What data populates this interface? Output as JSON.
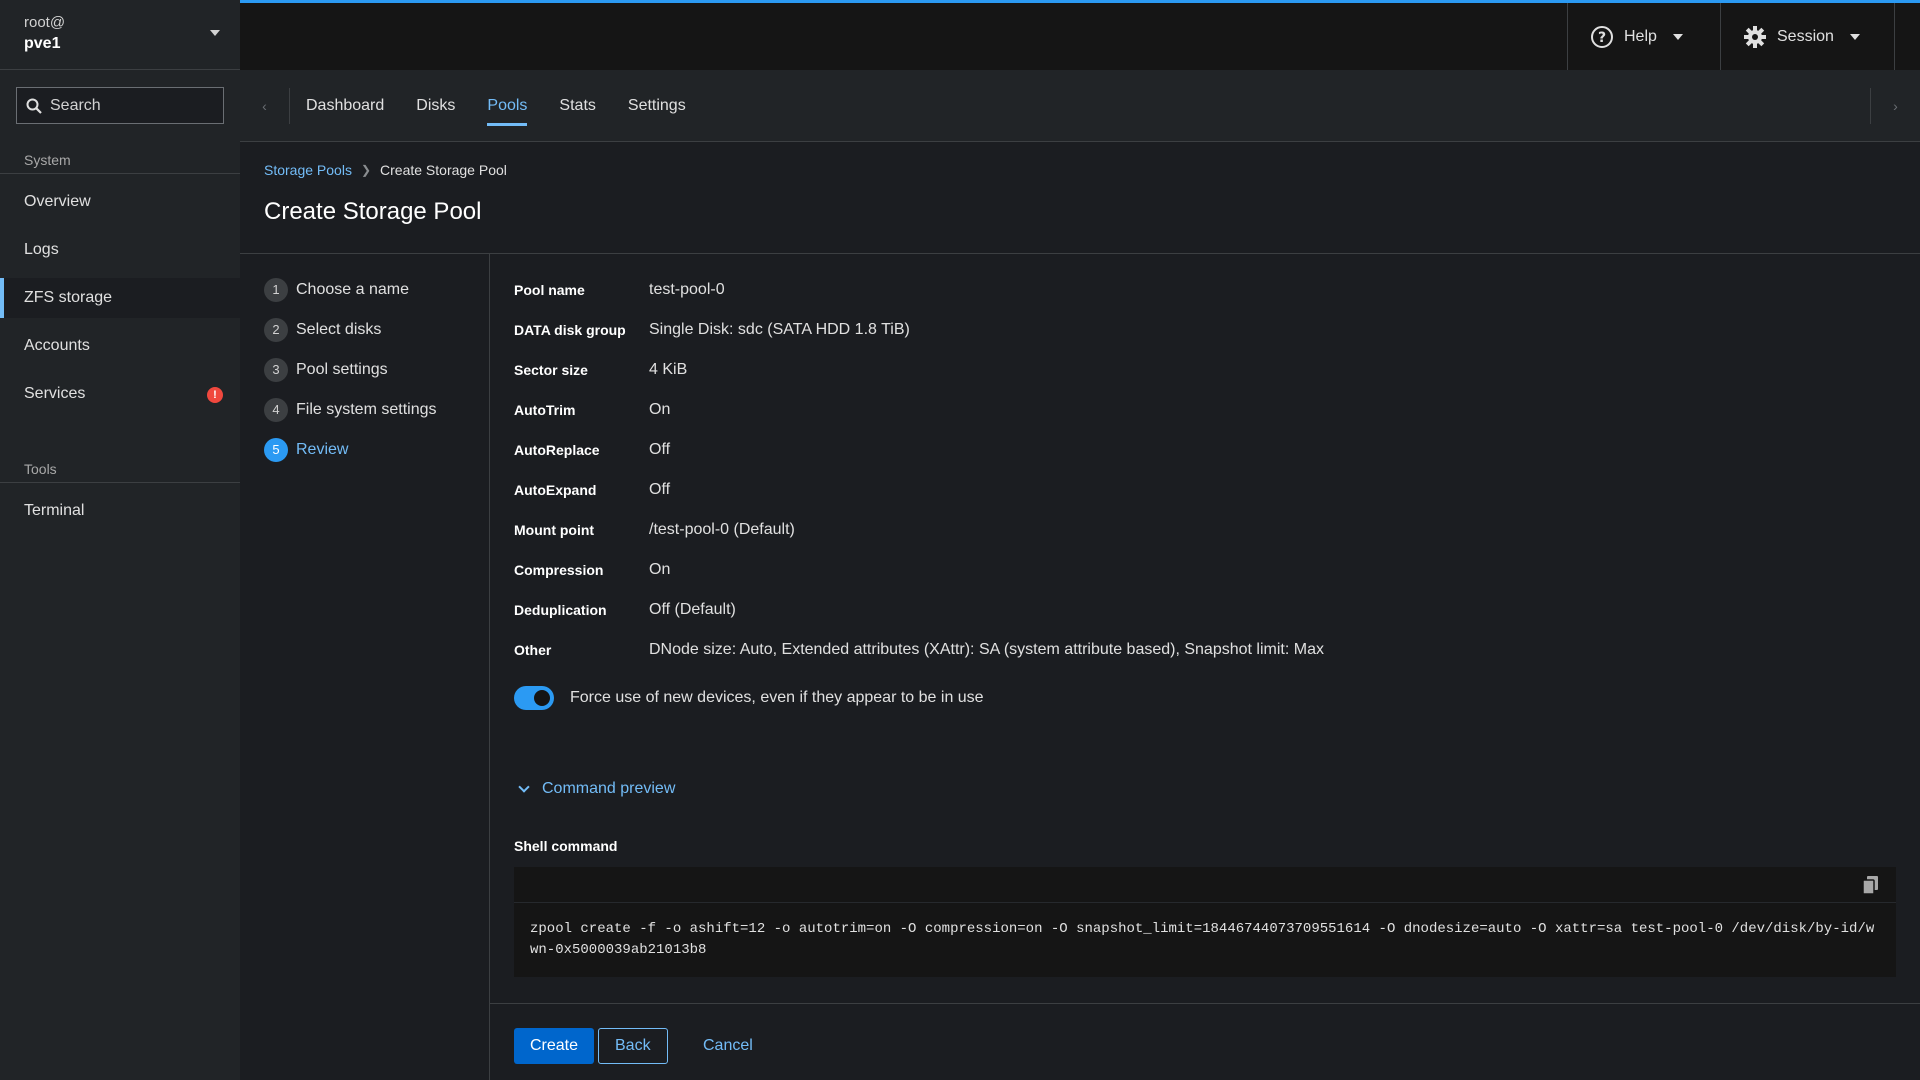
{
  "host": {
    "user": "root@",
    "name": "pve1"
  },
  "search": {
    "placeholder": "Search"
  },
  "nav": {
    "system_heading": "System",
    "system_items": [
      {
        "label": "Overview"
      },
      {
        "label": "Logs"
      },
      {
        "label": "ZFS storage",
        "active": true
      },
      {
        "label": "Accounts"
      },
      {
        "label": "Services",
        "badge": "!"
      }
    ],
    "tools_heading": "Tools",
    "tools_items": [
      {
        "label": "Terminal"
      }
    ]
  },
  "topbar": {
    "help_label": "Help",
    "session_label": "Session"
  },
  "tabs": [
    {
      "label": "Dashboard"
    },
    {
      "label": "Disks"
    },
    {
      "label": "Pools",
      "active": true
    },
    {
      "label": "Stats"
    },
    {
      "label": "Settings"
    }
  ],
  "breadcrumb": {
    "parent": "Storage Pools",
    "current": "Create Storage Pool"
  },
  "page_title": "Create Storage Pool",
  "steps": [
    {
      "num": "1",
      "label": "Choose a name"
    },
    {
      "num": "2",
      "label": "Select disks"
    },
    {
      "num": "3",
      "label": "Pool settings"
    },
    {
      "num": "4",
      "label": "File system settings"
    },
    {
      "num": "5",
      "label": "Review",
      "active": true
    }
  ],
  "review": [
    {
      "key": "Pool name",
      "value": "test-pool-0"
    },
    {
      "key": "DATA disk group",
      "value": "Single Disk: sdc (SATA HDD 1.8 TiB)"
    },
    {
      "key": "Sector size",
      "value": "4 KiB"
    },
    {
      "key": "AutoTrim",
      "value": "On"
    },
    {
      "key": "AutoReplace",
      "value": "Off"
    },
    {
      "key": "AutoExpand",
      "value": "Off"
    },
    {
      "key": "Mount point",
      "value": "/test-pool-0 (Default)"
    },
    {
      "key": "Compression",
      "value": "On"
    },
    {
      "key": "Deduplication",
      "value": "Off (Default)"
    },
    {
      "key": "Other",
      "value": "DNode size: Auto, Extended attributes (XAttr): SA (system attribute based), Snapshot limit: Max"
    }
  ],
  "force_toggle": {
    "label": "Force use of new devices, even if they appear to be in use",
    "on": true
  },
  "command_preview": {
    "label": "Command preview",
    "shell_label": "Shell command",
    "command": "zpool create -f -o ashift=12 -o autotrim=on -O compression=on -O snapshot_limit=18446744073709551614 -O dnodesize=auto -O xattr=sa test-pool-0 /dev/disk/by-id/wwn-0x5000039ab21013b8"
  },
  "buttons": {
    "create": "Create",
    "back": "Back",
    "cancel": "Cancel"
  },
  "colors": {
    "accent": "#73bcf7",
    "primary": "#0066cc",
    "badge": "#f0483e"
  }
}
